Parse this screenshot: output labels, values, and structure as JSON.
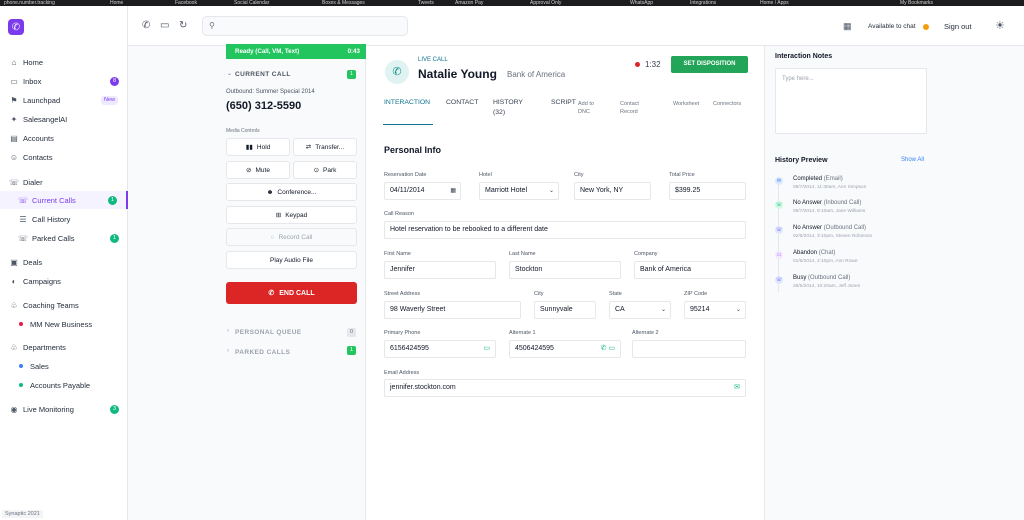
{
  "bookmarks": [
    "phone.number.tracking",
    "Home",
    "Facebook",
    "Social Calendar",
    "Boxes & Messages",
    "Tweets",
    "Amazon Pay",
    "Approval Only",
    "WhatsApp",
    "Integrations",
    "Home / Apps",
    "My Bookmarks"
  ],
  "sidebar": {
    "logo_glyph": "✆",
    "items": [
      {
        "label": "Home",
        "icon": "home-icon",
        "glyph": "⌂"
      },
      {
        "label": "Inbox",
        "icon": "inbox-icon",
        "glyph": "▭",
        "badge": "8"
      },
      {
        "label": "Launchpad",
        "icon": "launchpad-icon",
        "glyph": "⚑",
        "badge": "New"
      },
      {
        "label": "SalesangelAI",
        "icon": "ai-icon",
        "glyph": "✦"
      },
      {
        "label": "Accounts",
        "icon": "accounts-icon",
        "glyph": "▤"
      },
      {
        "label": "Contacts",
        "icon": "contacts-icon",
        "glyph": "☺"
      },
      {
        "label": "Dialer",
        "icon": "dialer-icon",
        "glyph": "☏"
      },
      {
        "label": "Current Calls",
        "icon": "current-calls-icon",
        "glyph": "☏",
        "badge": "1"
      },
      {
        "label": "Call History",
        "icon": "call-history-icon",
        "glyph": "☰"
      },
      {
        "label": "Parked Calls",
        "icon": "parked-calls-icon",
        "glyph": "☏",
        "badge": "1"
      },
      {
        "label": "Deals",
        "icon": "deals-icon",
        "glyph": "▣"
      },
      {
        "label": "Campaigns",
        "icon": "campaigns-icon",
        "glyph": "◐"
      },
      {
        "label": "Coaching Teams",
        "icon": "coaching-icon",
        "glyph": "♧"
      },
      {
        "label": "MM New Business",
        "dot_color": "#e11d48"
      },
      {
        "label": "Departments",
        "icon": "departments-icon",
        "glyph": "♧"
      },
      {
        "label": "Sales",
        "dot_color": "#3b82f6"
      },
      {
        "label": "Accounts Payable",
        "dot_color": "#10b981"
      },
      {
        "label": "Live Monitoring",
        "icon": "monitoring-icon",
        "glyph": "◉",
        "badge": "3"
      }
    ],
    "version": "Synaptic 2021"
  },
  "topbar": {
    "search_placeholder": "",
    "available_label": "Available to chat",
    "signout_label": "Sign out"
  },
  "call": {
    "status": "Ready (Call, VM, Text)",
    "timer": "0:43",
    "current_call_header": "CURRENT CALL",
    "current_call_count": "1",
    "campaign": "Outbound: Summer Special 2014",
    "phone": "(650) 312-5590",
    "media_controls_label": "Media Controls",
    "buttons": {
      "hold": "Hold",
      "transfer": "Transfer...",
      "mute": "Mute",
      "park": "Park",
      "conference": "Conference...",
      "keypad": "Keypad",
      "record": "Record Call",
      "play_audio": "Play Audio File",
      "end_call": "END CALL"
    },
    "personal_queue_label": "PERSONAL QUEUE",
    "personal_queue_count": "0",
    "parked_calls_label": "PARKED CALLS",
    "parked_calls_count": "1"
  },
  "contact": {
    "live_label": "LIVE CALL",
    "name": "Natalie Young",
    "company": "Bank of America",
    "duration": "1:32",
    "disposition_button": "SET DISPOSITION"
  },
  "tabs": {
    "interaction": "INTERACTION",
    "contact": "CONTACT",
    "history": "HISTORY",
    "history_count": "(32)",
    "script": "SCRIPT",
    "add_dnc_1": "Add to",
    "add_dnc_2": "DNC",
    "contact_record_1": "Contact",
    "contact_record_2": "Record",
    "worksheet": "Worksheet",
    "connectors": "Connectors"
  },
  "form": {
    "section_title": "Personal Info",
    "labels": {
      "reservation_date": "Reservation Date",
      "hotel": "Hotel",
      "city": "City",
      "total_price": "Total Price",
      "call_reason": "Call Reason",
      "first_name": "First Name",
      "last_name": "Last Name",
      "company": "Company",
      "street": "Street Address",
      "city2": "City",
      "state": "State",
      "zip": "ZIP Code",
      "primary_phone": "Primary Phone",
      "alternate1": "Alternate 1",
      "alternate2": "Alternate 2",
      "email": "Email Address"
    },
    "values": {
      "reservation_date": "04/11/2014",
      "hotel": "Marriott Hotel",
      "city": "New York, NY",
      "total_price": "$399.25",
      "call_reason": "Hotel reservation to be rebooked to a different date",
      "first_name": "Jennifer",
      "last_name": "Stockton",
      "company": "Bank of America",
      "street": "98 Waverly Street",
      "city2": "Sunnyvale",
      "state": "CA",
      "zip": "95214",
      "primary_phone": "6156424595",
      "alternate1": "4506424595",
      "alternate2": "",
      "email": "jennifer.stockton.com"
    }
  },
  "notes": {
    "title": "Interaction Notes",
    "placeholder": "Type here..."
  },
  "history": {
    "title": "History Preview",
    "show_all": "Show All",
    "items": [
      {
        "title": "Completed",
        "detail": "(Email)",
        "sub": "09/7/2014, 11:30am, Ann Simpson",
        "color": "#3b82f6",
        "glyph": "✉"
      },
      {
        "title": "No Answer",
        "detail": "(Inbound Call)",
        "sub": "05/7/2014, 9:10am, Jane Williams",
        "color": "#10b981",
        "glyph": "☏"
      },
      {
        "title": "No Answer",
        "detail": "(Outbound Call)",
        "sub": "02/6/2014, 3:10pm, Steven Robinson",
        "color": "#6366f1",
        "glyph": "☏"
      },
      {
        "title": "Abandon",
        "detail": "(Chat)",
        "sub": "01/6/2014, 2:10pm, Ann Rowe",
        "color": "#a855f7",
        "glyph": "▭"
      },
      {
        "title": "Busy",
        "detail": "(Outbound Call)",
        "sub": "28/5/2014, 10:20am, Jeff Jones",
        "color": "#6366f1",
        "glyph": "☏"
      }
    ]
  }
}
